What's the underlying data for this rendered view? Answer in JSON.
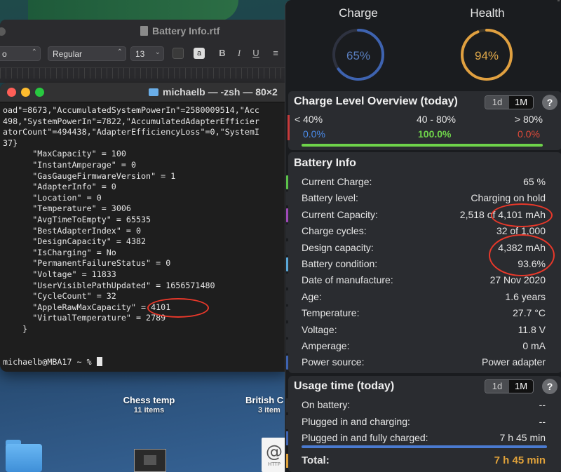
{
  "textedit": {
    "title": "Battery Info.rtf",
    "style_select": "Regular",
    "size_select": "13",
    "font_select_partial": "o"
  },
  "terminal": {
    "title": "michaelb — -zsh — 80×2",
    "lines": [
      "oad\"=8673,\"AccumulatedSystemPowerIn\"=2580009514,\"Acc",
      "498,\"SystemPowerIn\"=7822,\"AccumulatedAdapterEfficier",
      "atorCount\"=494438,\"AdapterEfficiencyLoss\"=0,\"SystemI",
      "37}",
      "      \"MaxCapacity\" = 100",
      "      \"InstantAmperage\" = 0",
      "      \"GasGaugeFirmwareVersion\" = 1",
      "      \"AdapterInfo\" = 0",
      "      \"Location\" = 0",
      "      \"Temperature\" = 3006",
      "      \"AvgTimeToEmpty\" = 65535",
      "      \"BestAdapterIndex\" = 0",
      "      \"DesignCapacity\" = 4382",
      "      \"IsCharging\" = No",
      "      \"PermanentFailureStatus\" = 0",
      "      \"Voltage\" = 11833",
      "      \"UserVisiblePathUpdated\" = 1656571480",
      "      \"CycleCount\" = 32",
      "      \"AppleRawMaxCapacity\" = 4101",
      "      \"VirtualTemperature\" = 2789",
      "    }",
      "",
      "",
      "michaelb@MBA17 ~ % "
    ]
  },
  "desktop": {
    "items": [
      {
        "name": "Chess temp",
        "sub": "11 items"
      },
      {
        "name": "British C",
        "sub": "3 item"
      }
    ],
    "http_label": "HTTP"
  },
  "rings": {
    "charge_label": "Charge",
    "charge_value": "65%",
    "charge_fraction": 0.65,
    "health_label": "Health",
    "health_value": "94%",
    "health_fraction": 0.94,
    "charge_color": "#3e63b0",
    "health_color": "#e0a040"
  },
  "overview": {
    "title": "Charge Level Overview (today)",
    "seg": [
      "1d",
      "1M"
    ],
    "help": "?",
    "cols": [
      {
        "label": "< 40%",
        "value": "0.0%",
        "color": "#4a8ae8"
      },
      {
        "label": "40 - 80%",
        "value": "100.0%",
        "color": "#6ed34a"
      },
      {
        "label": "> 80%",
        "value": "0.0%",
        "color": "#e04a3a"
      }
    ]
  },
  "battery_info": {
    "title": "Battery Info",
    "rows": [
      {
        "k": "Current Charge:",
        "v": "65 %",
        "mark": "#5cc24a"
      },
      {
        "k": "Battery level:",
        "v": "Charging on hold",
        "mark": "#2a2c30"
      },
      {
        "k": "Current Capacity:",
        "v": "2,518 of 4,101 mAh",
        "mark": "#a04ab8"
      },
      {
        "k": "Charge cycles:",
        "v": "32 of 1,000",
        "mark": "#2a2c30"
      },
      {
        "k": "Design capacity:",
        "v": "4,382 mAh",
        "mark": "#2a2c30"
      },
      {
        "k": "Battery condition:",
        "v": "93.6%",
        "mark": "#5aa8d8"
      },
      {
        "k": "Date of manufacture:",
        "v": "27 Nov 2020",
        "mark": "#2a2c30"
      },
      {
        "k": "Age:",
        "v": "1.6 years",
        "mark": "#2a2c30"
      },
      {
        "k": "Temperature:",
        "v": "27.7 °C",
        "mark": "#2a2c30"
      },
      {
        "k": "Voltage:",
        "v": "11.8 V",
        "mark": "#2a2c30"
      },
      {
        "k": "Amperage:",
        "v": "0 mA",
        "mark": "#2a2c30"
      },
      {
        "k": "Power source:",
        "v": "Power adapter",
        "mark": "#3e63b0"
      }
    ]
  },
  "usage": {
    "title": "Usage time (today)",
    "seg": [
      "1d",
      "1M"
    ],
    "help": "?",
    "rows": [
      {
        "k": "On battery:",
        "v": "--",
        "mark": "#2a2c30"
      },
      {
        "k": "Plugged in and charging:",
        "v": "--",
        "mark": "#2a2c30"
      },
      {
        "k": "Plugged in and fully charged:",
        "v": "7 h 45 min",
        "mark": "#3e63b0"
      }
    ],
    "total_label": "Total:",
    "total_value": "7 h 45 min"
  }
}
